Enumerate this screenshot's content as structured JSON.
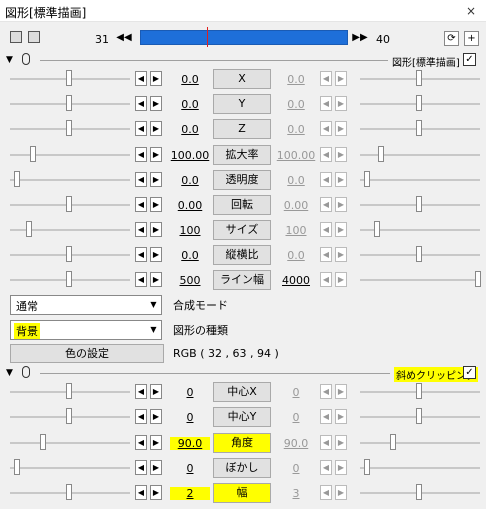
{
  "window": {
    "title": "図形[標準描画]",
    "close": "×"
  },
  "timeline": {
    "start": "31",
    "end": "40",
    "nav_prev": "◀◀",
    "nav_next": "▶▶",
    "loop_icon": "⟳",
    "add_icon": "+"
  },
  "section1": {
    "label": "図形[標準描画]",
    "checked": "✓",
    "arrow": "▼"
  },
  "params1": [
    {
      "name": "X",
      "left": "0.0",
      "right": "0.0"
    },
    {
      "name": "Y",
      "left": "0.0",
      "right": "0.0"
    },
    {
      "name": "Z",
      "left": "0.0",
      "right": "0.0"
    },
    {
      "name": "拡大率",
      "left": "100.00",
      "right": "100.00"
    },
    {
      "name": "透明度",
      "left": "0.0",
      "right": "0.0"
    },
    {
      "name": "回転",
      "left": "0.00",
      "right": "0.00"
    },
    {
      "name": "サイズ",
      "left": "100",
      "right": "100"
    },
    {
      "name": "縦横比",
      "left": "0.0",
      "right": "0.0"
    },
    {
      "name": "ライン幅",
      "left": "500",
      "right": "4000"
    }
  ],
  "blend": {
    "value": "通常",
    "label": "合成モード"
  },
  "shape": {
    "value": "背景",
    "label": "図形の種類"
  },
  "color": {
    "button": "色の設定",
    "rgb": "RGB ( 32 , 63 , 94 )"
  },
  "section2": {
    "label": "斜めクリッピング",
    "checked": "✓",
    "arrow": "▼"
  },
  "params2": [
    {
      "name": "中心X",
      "left": "0",
      "right": "0"
    },
    {
      "name": "中心Y",
      "left": "0",
      "right": "0"
    },
    {
      "name": "角度",
      "left": "90.0",
      "right": "90.0"
    },
    {
      "name": "ぼかし",
      "left": "0",
      "right": "0"
    },
    {
      "name": "幅",
      "left": "2",
      "right": "3"
    }
  ],
  "spin": {
    "left": "◀",
    "right": "▶"
  },
  "dropdown_icon": "▼"
}
